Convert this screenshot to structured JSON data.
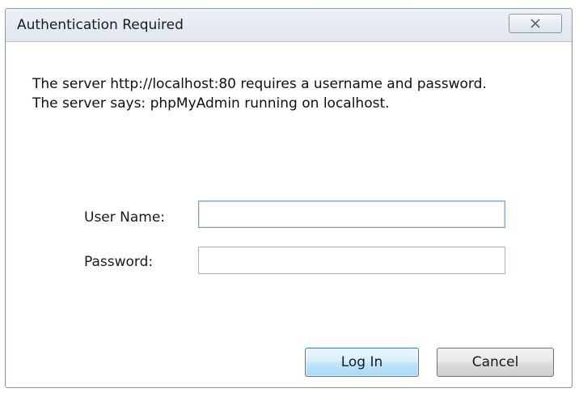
{
  "dialog": {
    "title": "Authentication Required",
    "close_icon": "close-icon",
    "message": "The server http://localhost:80 requires a username and password. The server says: phpMyAdmin running on localhost."
  },
  "form": {
    "username_label": "User Name:",
    "username_value": "",
    "password_label": "Password:",
    "password_value": ""
  },
  "buttons": {
    "login": "Log In",
    "cancel": "Cancel"
  },
  "colors": {
    "default_button_border": "#3c7fb1",
    "focus_border": "#7aa3d1"
  }
}
